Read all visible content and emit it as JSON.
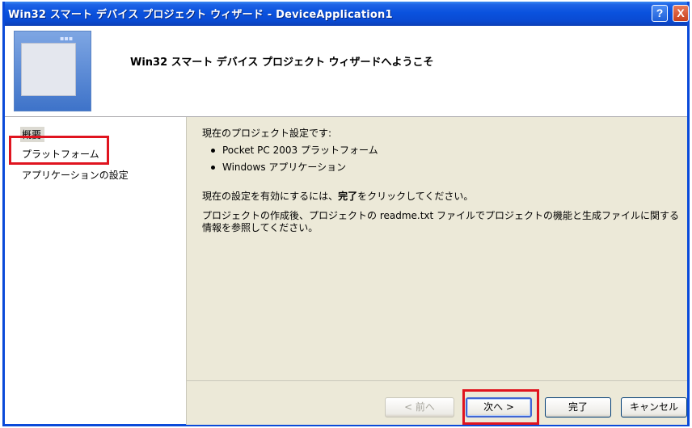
{
  "window": {
    "title": "Win32 スマート デバイス プロジェクト ウィザード - DeviceApplication1",
    "help_label": "?",
    "close_label": "X"
  },
  "header": {
    "title": "Win32 スマート デバイス プロジェクト ウィザードへようこそ"
  },
  "sidebar": {
    "items": [
      {
        "label": "概要"
      },
      {
        "label": "プラットフォーム"
      },
      {
        "label": "アプリケーションの設定"
      }
    ]
  },
  "content": {
    "intro": "現在のプロジェクト設定です:",
    "bullets": [
      "Pocket PC 2003 プラットフォーム",
      "Windows アプリケーション"
    ],
    "finish_pre": "現在の設定を有効にするには、",
    "finish_bold": "完了",
    "finish_post": "をクリックしてください。",
    "readme": "プロジェクトの作成後、プロジェクトの readme.txt ファイルでプロジェクトの機能と生成ファイルに関する情報を参照してください。"
  },
  "buttons": {
    "prev": "< 前へ",
    "next": "次へ >",
    "finish": "完了",
    "cancel": "キャンセル"
  },
  "colors": {
    "highlight": "#e0141f",
    "titlebar": "#0a52de"
  }
}
